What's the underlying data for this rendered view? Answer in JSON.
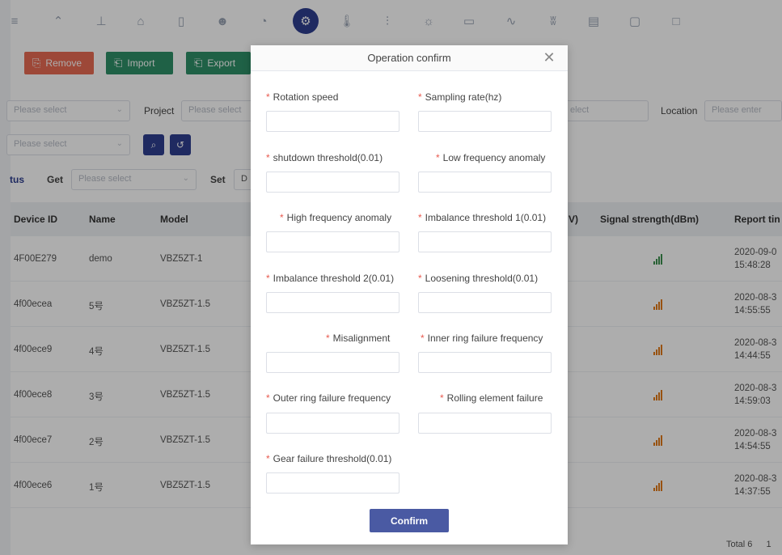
{
  "toolbar": {
    "remove_label": "Remove",
    "import_label": "Import",
    "export_label": "Export",
    "icons": [
      "menu-icon",
      "signal-tower-icon",
      "flask-icon",
      "factory-icon",
      "phone-icon",
      "users-icon",
      "gauge-icon",
      "settings-active-icon",
      "thermometer-icon",
      "chart-icon",
      "bulb-icon",
      "monitor-icon",
      "waveform-icon",
      "fire-icon",
      "panel-icon",
      "document-icon",
      "square-icon"
    ]
  },
  "filters": {
    "project_label": "Project",
    "location_label": "Location",
    "please_select": "Please select",
    "please_enter": "Please enter",
    "select_partial": "elect",
    "status_label": "tus",
    "get_label": "Get",
    "set_label": "Set",
    "set_value_partial": "D"
  },
  "table": {
    "headers": {
      "device_id": "Device ID",
      "name": "Name",
      "model": "Model",
      "voltage_partial": "V)",
      "signal": "Signal strength(dBm)",
      "report_time": "Report tin"
    },
    "rows": [
      {
        "device_id": "4F00E279",
        "name": "demo",
        "model": "VBZ5ZT-1",
        "date": "2020-09-0",
        "time": "15:48:28",
        "signal_ok": true
      },
      {
        "device_id": "4f00ecea",
        "name": "5号",
        "model": "VBZ5ZT-1.5",
        "date": "2020-08-3",
        "time": "14:55:55",
        "signal_ok": false
      },
      {
        "device_id": "4f00ece9",
        "name": "4号",
        "model": "VBZ5ZT-1.5",
        "date": "2020-08-3",
        "time": "14:44:55",
        "signal_ok": false
      },
      {
        "device_id": "4f00ece8",
        "name": "3号",
        "model": "VBZ5ZT-1.5",
        "date": "2020-08-3",
        "time": "14:59:03",
        "signal_ok": false
      },
      {
        "device_id": "4f00ece7",
        "name": "2号",
        "model": "VBZ5ZT-1.5",
        "date": "2020-08-3",
        "time": "14:54:55",
        "signal_ok": false
      },
      {
        "device_id": "4f00ece6",
        "name": "1号",
        "model": "VBZ5ZT-1.5",
        "date": "2020-08-3",
        "time": "14:37:55",
        "signal_ok": false
      }
    ],
    "total_text": "Total 6",
    "page_partial": "1"
  },
  "modal": {
    "title": "Operation confirm",
    "confirm_label": "Confirm",
    "required_mark": "*",
    "fields": {
      "rotation_speed": "Rotation speed",
      "sampling_rate": "Sampling rate(hz)",
      "shutdown_threshold": "shutdown threshold(0.01)",
      "low_freq": "Low frequency anomaly",
      "high_freq": "High frequency anomaly",
      "imbalance1": "Imbalance threshold 1(0.01)",
      "imbalance2": "Imbalance threshold 2(0.01)",
      "loosening": "Loosening threshold(0.01)",
      "misalignment": "Misalignment",
      "inner_ring": "Inner ring failure frequency",
      "outer_ring": "Outer ring failure frequency",
      "rolling": "Rolling element failure",
      "gear": "Gear failure threshold(0.01)"
    }
  },
  "colors": {
    "primary": "#2f3f8f",
    "danger": "#e86b53",
    "success": "#2f8f67",
    "confirm": "#4a5aa3",
    "required": "#e85a4f"
  }
}
